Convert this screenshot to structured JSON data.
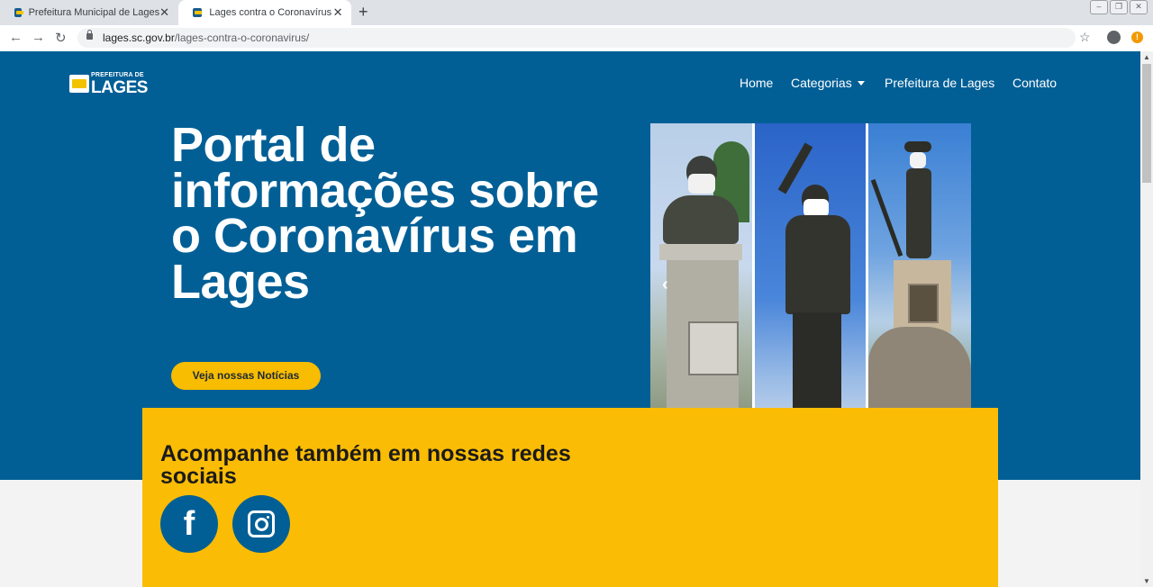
{
  "browser": {
    "tabs": [
      {
        "label": "Prefeitura Municipal de Lages",
        "active": false
      },
      {
        "label": "Lages contra o Coronavírus",
        "active": true
      }
    ],
    "url_domain": "lages.sc.gov.br",
    "url_path": "/lages-contra-o-coronavirus/",
    "new_tab_symbol": "+",
    "close_symbol": "✕",
    "alert_symbol": "!"
  },
  "site": {
    "logo": {
      "top": "PREFEITURA DE",
      "main": "LAGES"
    },
    "nav": [
      {
        "label": "Home"
      },
      {
        "label": "Categorias",
        "dropdown": true
      },
      {
        "label": "Prefeitura de Lages"
      },
      {
        "label": "Contato"
      }
    ],
    "hero": {
      "headline": "Portal de informações sobre o Coronavírus em Lages",
      "cta_label": "Veja nossas Notícias"
    },
    "social": {
      "title": "Acompanhe também em nossas redes sociais",
      "networks": [
        {
          "name": "facebook",
          "icon": "facebook-icon"
        },
        {
          "name": "instagram",
          "icon": "instagram-icon"
        }
      ]
    }
  },
  "colors": {
    "brand_blue": "#015f96",
    "brand_yellow": "#fbbc05",
    "button_yellow": "#f8bc00"
  }
}
